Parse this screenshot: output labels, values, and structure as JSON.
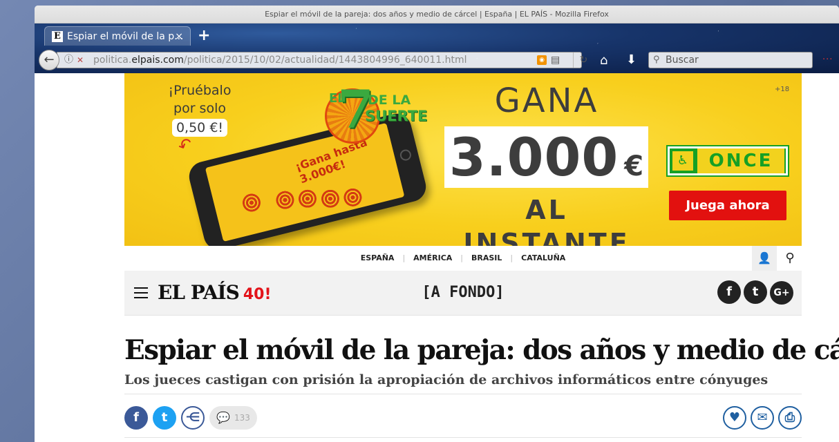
{
  "window": {
    "title": "Espiar el móvil de la pareja: dos años y medio de cárcel | España | EL PAÍS - Mozilla Firefox"
  },
  "tabs": [
    {
      "label": "Espiar el móvil de la p...",
      "favicon": "E",
      "active": true
    }
  ],
  "toolbar": {
    "url_prefix": "politica.",
    "url_domain": "elpais.com",
    "url_path": "/politica/2015/10/02/actualidad/1443804996_640011.html",
    "search_placeholder": "Buscar",
    "new_tab_label": "+",
    "close_tab_label": "×"
  },
  "ad": {
    "promo_line1": "¡Pruébalo",
    "promo_line2": "por solo",
    "promo_price": "0,50 €!",
    "logo_el": "EL",
    "logo_seven": "7",
    "logo_dela": "DE LA",
    "logo_suerte": "SUERTE",
    "phone_text": "¡Gana hasta 3.000€!",
    "gana": "GANA",
    "amount": "3.000",
    "currency": "€",
    "instante": "AL INSTANTE",
    "age_limit": "+18",
    "once_label": "ONCE",
    "cta": "Juega ahora",
    "colors": {
      "background": "#f8cf1d",
      "cta": "#e2110f",
      "once_green": "#16a025"
    }
  },
  "editions": [
    "ESPAÑA",
    "AMÉRICA",
    "BRASIL",
    "CATALUÑA"
  ],
  "masthead": {
    "brand": "EL PAÍS",
    "anniversary": "40!",
    "section": "[A FONDO]",
    "social": [
      "f",
      "t",
      "G+"
    ]
  },
  "article": {
    "headline": "Espiar el móvil de la pareja: dos años y medio de cárcel",
    "subheadline": "Los jueces castigan con prisión la apropiación de archivos informáticos entre cónyuges",
    "comment_count": "133"
  }
}
